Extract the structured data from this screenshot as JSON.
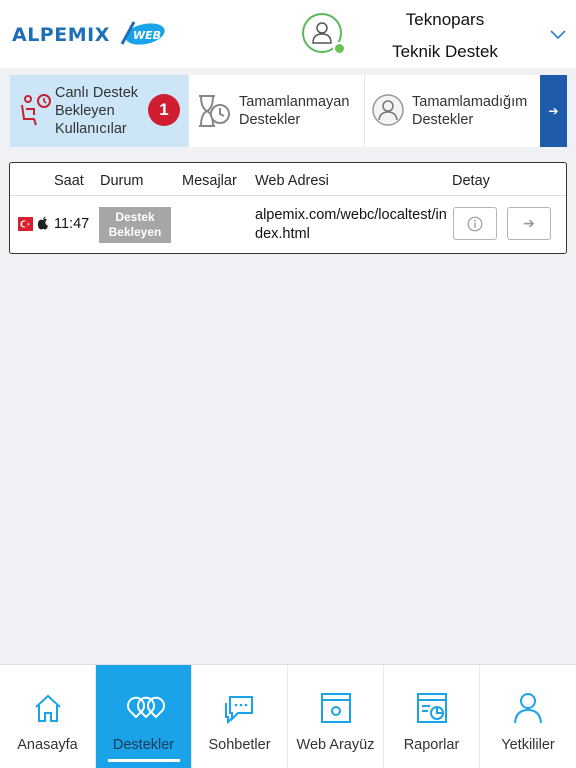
{
  "header": {
    "logo_text": "ALPEMIX",
    "logo_badge": "WEB",
    "user_name": "Teknopars",
    "user_role": "Teknik Destek"
  },
  "tabs": [
    {
      "label": "Canlı Destek Bekleyen Kullanıcılar",
      "badge": "1",
      "active": true
    },
    {
      "label": "Tamamlanmayan Destekler",
      "active": false
    },
    {
      "label": "Tamamlamadığım Destekler",
      "active": false
    }
  ],
  "tabs_next": "➔",
  "table": {
    "headers": {
      "saat": "Saat",
      "durum": "Durum",
      "mesajlar": "Mesajlar",
      "web": "Web Adresi",
      "detay": "Detay"
    },
    "rows": [
      {
        "time": "11:47",
        "status": "Destek Bekleyen",
        "url": "alpemix.com/webc/localtest/index.html",
        "go": "➔"
      }
    ]
  },
  "bottom_nav": [
    {
      "label": "Anasayfa",
      "icon": "home-icon",
      "active": false
    },
    {
      "label": "Destekler",
      "icon": "support-pins-icon",
      "active": true
    },
    {
      "label": "Sohbetler",
      "icon": "chat-icon",
      "active": false
    },
    {
      "label": "Web Arayüz",
      "icon": "web-window-icon",
      "active": false
    },
    {
      "label": "Raporlar",
      "icon": "report-icon",
      "active": false
    },
    {
      "label": "Yetkililer",
      "icon": "user-icon",
      "active": false
    }
  ],
  "colors": {
    "brand": "#1e6fb8",
    "accent": "#1aa3e8",
    "badge": "#cf1e2f",
    "online": "#6ac259",
    "active_tab": "#cce6f7"
  }
}
